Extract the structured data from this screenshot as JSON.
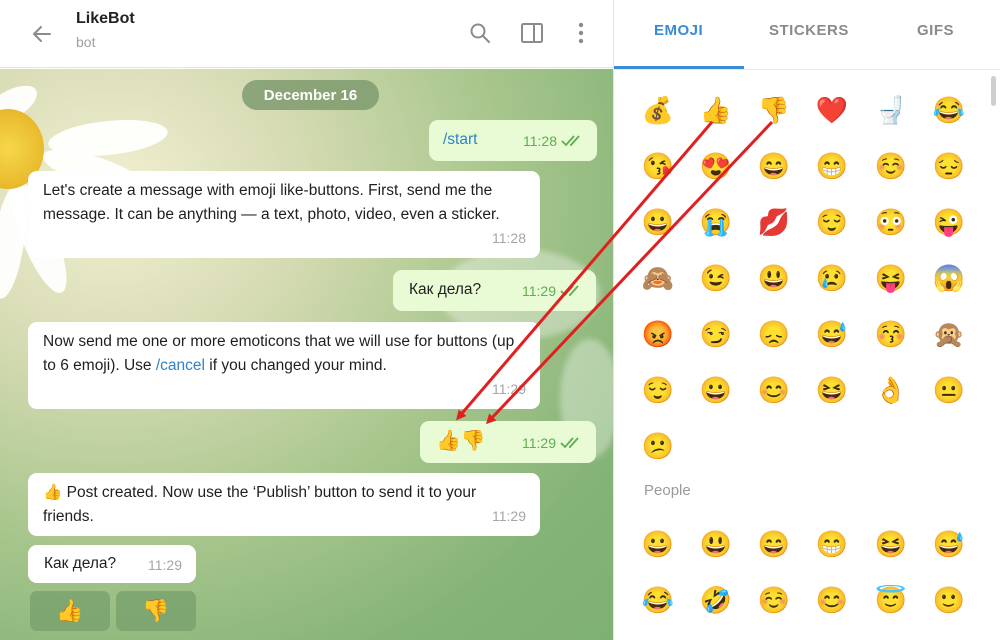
{
  "header": {
    "title": "LikeBot",
    "subtitle": "bot"
  },
  "chat": {
    "date": "December 16",
    "messages": [
      {
        "dir": "out",
        "text": "/start",
        "time": "11:28",
        "read": true
      },
      {
        "dir": "in",
        "text": "Let's create a message with emoji like-buttons. First, send me the message. It can be anything — a text, photo, video, even a sticker.",
        "time": "11:28"
      },
      {
        "dir": "out",
        "text": "Как дела?",
        "time": "11:29",
        "read": true
      },
      {
        "dir": "in",
        "text_before": "Now send me one or more emoticons that we will use for buttons (up to 6 emoji). Use ",
        "link": "/cancel",
        "text_after": " if you changed your mind.",
        "time": "11:29"
      },
      {
        "dir": "out",
        "text": "👍👎",
        "time": "11:29",
        "read": true
      },
      {
        "dir": "in",
        "text": "👍 Post created. Now use the ‘Publish’ button to send it to your friends.",
        "time": "11:29"
      },
      {
        "dir": "in",
        "text": "Как дела?",
        "time": "11:29"
      }
    ],
    "keyboard": [
      "👍",
      "👎"
    ]
  },
  "emoji_panel": {
    "tabs": [
      "EMOJI",
      "STICKERS",
      "GIFS"
    ],
    "active_tab": "EMOJI",
    "accent_color": "#3a8ad6",
    "recent": [
      "💰",
      "👍",
      "👎",
      "❤️",
      "🚽",
      "😂",
      "😘",
      "😍",
      "😄",
      "😁",
      "☺️",
      "😔",
      "😀",
      "😭",
      "💋",
      "😌",
      "😳",
      "😜",
      "🙈",
      "😉",
      "😃",
      "😢",
      "😝",
      "😱",
      "😡",
      "😏",
      "😞",
      "😅",
      "😚",
      "🙊",
      "😌",
      "😀",
      "😊",
      "😆",
      "👌",
      "😐",
      "😕"
    ],
    "people_label": "People",
    "people": [
      "😀",
      "😃",
      "😄",
      "😁",
      "😆",
      "😅",
      "😂",
      "🤣",
      "☺️",
      "😊",
      "😇",
      "🙂"
    ]
  },
  "annotation": {
    "arrow_color": "#e02020"
  }
}
